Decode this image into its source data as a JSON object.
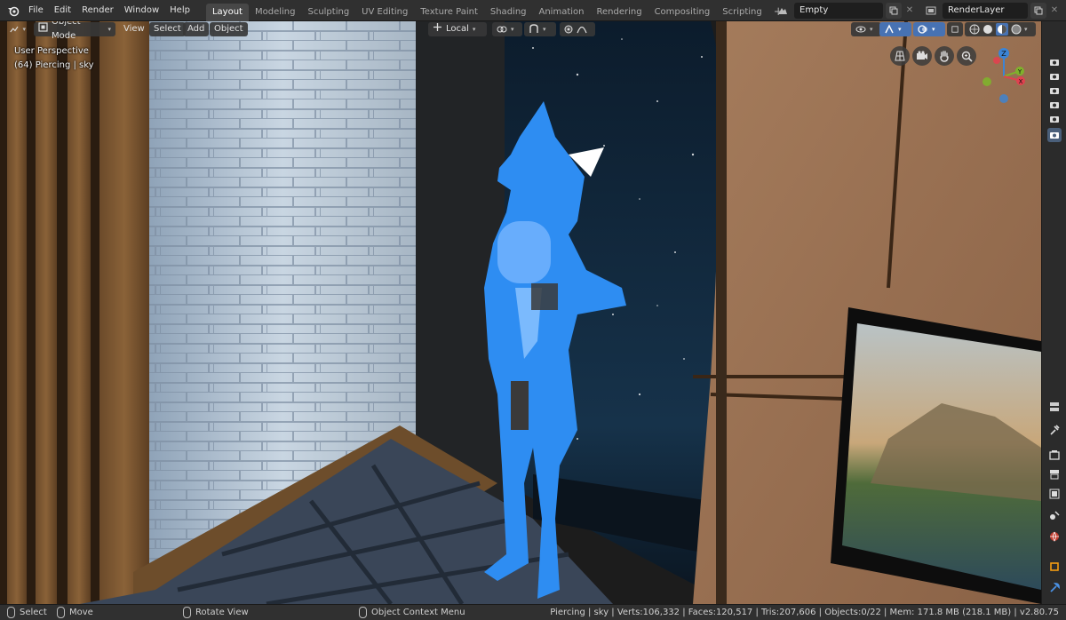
{
  "topbar": {
    "menus": [
      "File",
      "Edit",
      "Render",
      "Window",
      "Help"
    ],
    "workspaces": [
      "Layout",
      "Modeling",
      "Sculpting",
      "UV Editing",
      "Texture Paint",
      "Shading",
      "Animation",
      "Rendering",
      "Compositing",
      "Scripting"
    ],
    "active_workspace": "Layout",
    "add_tab": "+",
    "scene_name": "Empty",
    "view_layer": "RenderLayer",
    "close_glyph": "✕"
  },
  "viewport_header": {
    "mode": "Object Mode",
    "menus": [
      "View",
      "Select",
      "Add",
      "Object"
    ],
    "transform_orientation": "Local"
  },
  "overlay": {
    "view_name": "User Perspective",
    "object_info": "(64) Piercing | sky"
  },
  "gizmo": {
    "z_label": "Z",
    "y_label": "Y",
    "x_label": "X"
  },
  "statusbar": {
    "select": "Select",
    "move": "Move",
    "rotate": "Rotate View",
    "context_menu": "Object Context Menu",
    "stats": "Piercing | sky | Verts:106,332 | Faces:120,517 | Tris:207,606 | Objects:0/22 | Mem: 171.8 MB (218.1 MB) | v2.80.75"
  },
  "colors": {
    "accent": "#4772b3",
    "axis_x": "#e0414f",
    "axis_y": "#7fb12c",
    "axis_z": "#3b84d6",
    "character": "#2e8df2"
  },
  "icons": [
    "blender-logo-icon",
    "object-mode-icon",
    "editor-type-icon",
    "scene-icon",
    "view-layer-icon",
    "copy-icon",
    "camera-icon",
    "hand-icon",
    "zoom-icon",
    "grid-icon",
    "tool-icon",
    "render-icon",
    "output-icon",
    "view-layer-tab-icon",
    "scene-tab-icon",
    "world-icon",
    "object-tab-icon",
    "modifier-icon",
    "mouse-icon"
  ]
}
